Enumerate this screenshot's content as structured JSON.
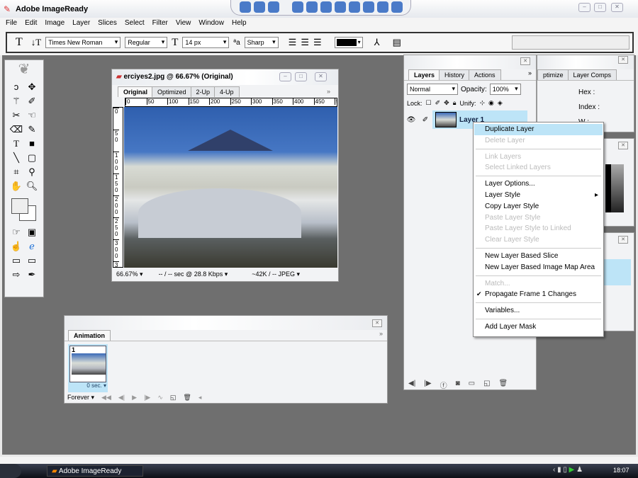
{
  "app": {
    "title": "Adobe ImageReady"
  },
  "menu": [
    "File",
    "Edit",
    "Image",
    "Layer",
    "Slices",
    "Select",
    "Filter",
    "View",
    "Window",
    "Help"
  ],
  "options": {
    "font_family": "Times New Roman",
    "font_style": "Regular",
    "font_size": "14 px",
    "antialias": "Sharp",
    "color": "#000000"
  },
  "document": {
    "title": "erciyes2.jpg @ 66.67% (Original)",
    "tabs": [
      "Original",
      "Optimized",
      "2-Up",
      "4-Up"
    ],
    "ruler_h": [
      "0",
      "50",
      "100",
      "150",
      "200",
      "250",
      "300",
      "350",
      "400",
      "450",
      "50"
    ],
    "ruler_v": [
      "0",
      "50",
      "100",
      "150",
      "200",
      "250",
      "300",
      "350"
    ],
    "zoom": "66.67%",
    "download": "-- / -- sec @ 28.8 Kbps",
    "size": "~42K / -- JPEG"
  },
  "animation": {
    "tab": "Animation",
    "frame_number": "1",
    "frame_delay": "0 sec.",
    "loop": "Forever"
  },
  "layers": {
    "tabs": [
      "Layers",
      "History",
      "Actions"
    ],
    "blend": "Normal",
    "opacity_label": "Opacity:",
    "opacity": "100%",
    "lock_label": "Lock:",
    "unify_label": "Unify:",
    "layer_name": "Layer 1"
  },
  "info_panel": {
    "tabs": [
      "ptimize",
      "Layer Comps"
    ],
    "hex_label": "Hex :",
    "index_label": "Index :",
    "w_label": "W :"
  },
  "context_menu": [
    {
      "label": "Duplicate Layer",
      "state": "highlighted"
    },
    {
      "label": "Delete Layer",
      "state": "disabled"
    },
    {
      "sep": true
    },
    {
      "label": "Link Layers",
      "state": "disabled"
    },
    {
      "label": "Select Linked Layers",
      "state": "disabled"
    },
    {
      "sep": true
    },
    {
      "label": "Layer Options...",
      "state": "enabled"
    },
    {
      "label": "Layer Style",
      "state": "enabled",
      "submenu": true
    },
    {
      "label": "Copy Layer Style",
      "state": "enabled"
    },
    {
      "label": "Paste Layer Style",
      "state": "disabled"
    },
    {
      "label": "Paste Layer Style to Linked",
      "state": "disabled"
    },
    {
      "label": "Clear Layer Style",
      "state": "disabled"
    },
    {
      "sep": true
    },
    {
      "label": "New Layer Based Slice",
      "state": "enabled"
    },
    {
      "label": "New Layer Based Image Map Area",
      "state": "enabled"
    },
    {
      "sep": true
    },
    {
      "label": "Match...",
      "state": "disabled"
    },
    {
      "label": "Propagate Frame 1 Changes",
      "state": "enabled",
      "checked": true
    },
    {
      "sep": true
    },
    {
      "label": "Variables...",
      "state": "enabled"
    },
    {
      "sep": true
    },
    {
      "label": "Add Layer Mask",
      "state": "enabled"
    }
  ],
  "taskbar": {
    "task": "Adobe ImageReady",
    "clock": "18:07"
  },
  "colors": {
    "workspace": "#6f6f6f",
    "highlight": "#bde4f7"
  }
}
